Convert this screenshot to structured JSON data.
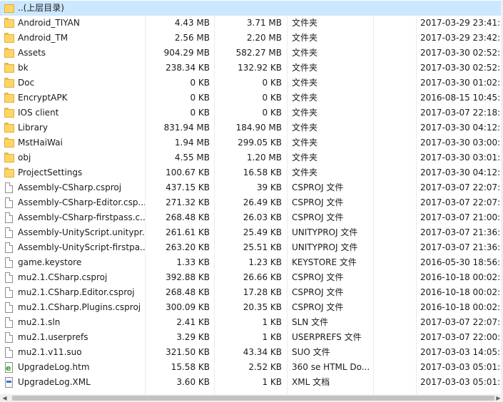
{
  "parent_row": {
    "name": "..(上层目录)"
  },
  "files": [
    {
      "name": "Android_TIYAN",
      "size": "4.43 MB",
      "packed": "3.71 MB",
      "type": "文件夹",
      "modified": "2017-03-29 23:41:...",
      "icon": "folder-icon"
    },
    {
      "name": "Android_TM",
      "size": "2.56 MB",
      "packed": "2.20 MB",
      "type": "文件夹",
      "modified": "2017-03-29 23:42:...",
      "icon": "folder-icon"
    },
    {
      "name": "Assets",
      "size": "904.29 MB",
      "packed": "582.27 MB",
      "type": "文件夹",
      "modified": "2017-03-30 02:52:...",
      "icon": "folder-icon"
    },
    {
      "name": "bk",
      "size": "238.34 KB",
      "packed": "132.92 KB",
      "type": "文件夹",
      "modified": "2017-03-30 02:52:...",
      "icon": "folder-icon"
    },
    {
      "name": "Doc",
      "size": "0 KB",
      "packed": "0 KB",
      "type": "文件夹",
      "modified": "2017-03-30 01:02:...",
      "icon": "folder-icon"
    },
    {
      "name": "EncryptAPK",
      "size": "0 KB",
      "packed": "0 KB",
      "type": "文件夹",
      "modified": "2016-08-15 10:45:...",
      "icon": "folder-icon"
    },
    {
      "name": "IOS client",
      "size": "0 KB",
      "packed": "0 KB",
      "type": "文件夹",
      "modified": "2017-03-07 22:18:...",
      "icon": "folder-icon"
    },
    {
      "name": "Library",
      "size": "831.94 MB",
      "packed": "184.90 MB",
      "type": "文件夹",
      "modified": "2017-03-30 04:12:...",
      "icon": "folder-icon"
    },
    {
      "name": "MstHaiWai",
      "size": "1.94 MB",
      "packed": "299.05 KB",
      "type": "文件夹",
      "modified": "2017-03-30 03:00:...",
      "icon": "folder-icon"
    },
    {
      "name": "obj",
      "size": "4.55 MB",
      "packed": "1.20 MB",
      "type": "文件夹",
      "modified": "2017-03-30 03:01:...",
      "icon": "folder-icon"
    },
    {
      "name": "ProjectSettings",
      "size": "100.67 KB",
      "packed": "16.58 KB",
      "type": "文件夹",
      "modified": "2017-03-30 04:12:...",
      "icon": "folder-icon"
    },
    {
      "name": "Assembly-CSharp.csproj",
      "size": "437.15 KB",
      "packed": "39 KB",
      "type": "CSPROJ 文件",
      "modified": "2017-03-07 22:07:...",
      "icon": "file-icon"
    },
    {
      "name": "Assembly-CSharp-Editor.csp...",
      "size": "271.32 KB",
      "packed": "26.49 KB",
      "type": "CSPROJ 文件",
      "modified": "2017-03-07 22:07:...",
      "icon": "file-icon"
    },
    {
      "name": "Assembly-CSharp-firstpass.c...",
      "size": "268.48 KB",
      "packed": "26.03 KB",
      "type": "CSPROJ 文件",
      "modified": "2017-03-07 21:00:...",
      "icon": "file-icon"
    },
    {
      "name": "Assembly-UnityScript.unitypr...",
      "size": "261.61 KB",
      "packed": "25.49 KB",
      "type": "UNITYPROJ 文件",
      "modified": "2017-03-07 21:36:...",
      "icon": "file-icon"
    },
    {
      "name": "Assembly-UnityScript-firstpa...",
      "size": "263.20 KB",
      "packed": "25.51 KB",
      "type": "UNITYPROJ 文件",
      "modified": "2017-03-07 21:36:...",
      "icon": "file-icon"
    },
    {
      "name": "game.keystore",
      "size": "1.33 KB",
      "packed": "1.23 KB",
      "type": "KEYSTORE 文件",
      "modified": "2016-05-30 18:56:...",
      "icon": "file-icon"
    },
    {
      "name": "mu2.1.CSharp.csproj",
      "size": "392.88 KB",
      "packed": "26.66 KB",
      "type": "CSPROJ 文件",
      "modified": "2016-10-18 00:02:...",
      "icon": "file-icon"
    },
    {
      "name": "mu2.1.CSharp.Editor.csproj",
      "size": "268.48 KB",
      "packed": "17.28 KB",
      "type": "CSPROJ 文件",
      "modified": "2016-10-18 00:02:...",
      "icon": "file-icon"
    },
    {
      "name": "mu2.1.CSharp.Plugins.csproj",
      "size": "300.09 KB",
      "packed": "20.35 KB",
      "type": "CSPROJ 文件",
      "modified": "2016-10-18 00:02:...",
      "icon": "file-icon"
    },
    {
      "name": "mu2.1.sln",
      "size": "2.41 KB",
      "packed": "1 KB",
      "type": "SLN 文件",
      "modified": "2017-03-07 22:07:...",
      "icon": "file-icon"
    },
    {
      "name": "mu2.1.userprefs",
      "size": "3.29 KB",
      "packed": "1 KB",
      "type": "USERPREFS 文件",
      "modified": "2017-03-07 22:00:...",
      "icon": "file-icon"
    },
    {
      "name": "mu2.1.v11.suo",
      "size": "321.50 KB",
      "packed": "43.34 KB",
      "type": "SUO 文件",
      "modified": "2017-03-03 14:05:...",
      "icon": "file-icon"
    },
    {
      "name": "UpgradeLog.htm",
      "size": "15.58 KB",
      "packed": "2.52 KB",
      "type": "360 se HTML Do...",
      "modified": "2017-03-03 05:01:...",
      "icon": "html-document-icon"
    },
    {
      "name": "UpgradeLog.XML",
      "size": "3.60 KB",
      "packed": "1 KB",
      "type": "XML 文档",
      "modified": "2017-03-03 05:01:...",
      "icon": "xml-document-icon"
    }
  ],
  "colors": {
    "selection": "#cce8ff",
    "folder": "#ffd568"
  }
}
